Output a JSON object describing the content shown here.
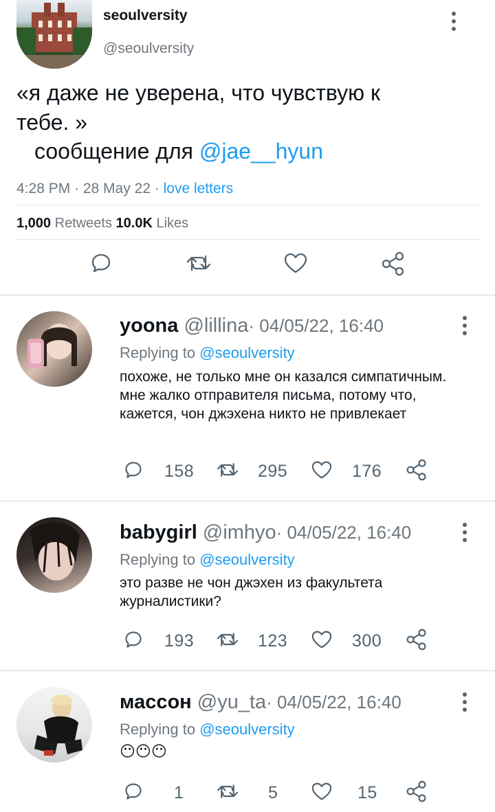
{
  "tweet": {
    "display_name": "seoulversity",
    "handle": "@seoulversity",
    "text_line1": "«я даже не уверена, что чувствую к",
    "text_line2": "тебе. »",
    "text_line3_prefix": "сообщение для ",
    "text_line3_mention": "@jae__hyun",
    "time": "4:28 PM · 28 May 22 · ",
    "source": "love letters",
    "retweets_count": "1,000",
    "retweets_label": " Retweets ",
    "likes_count": "10.0K",
    "likes_label": " Likes"
  },
  "replies": [
    {
      "name": "yoona",
      "handle": "@lillina",
      "timestamp": "· 04/05/22, 16:40",
      "replying_prefix": "Replying to ",
      "replying_handle": "@seoulversity",
      "text": "похоже, не только мне он казался симпатичным. мне жалко отправителя письма, потому что, кажется, чон джэхена никто не привлекает",
      "comments": "158",
      "retweets": "295",
      "likes": "176"
    },
    {
      "name": "babygirl",
      "handle": "@imhyo",
      "timestamp": "· 04/05/22, 16:40",
      "replying_prefix": "Replying to ",
      "replying_handle": "@seoulversity",
      "text": "это разве не чон джэхен из факультета журналистики?",
      "comments": "193",
      "retweets": "123",
      "likes": "300"
    },
    {
      "name": "массон",
      "handle": "@yu_ta",
      "timestamp": "· 04/05/22, 16:40",
      "replying_prefix": "Replying to ",
      "replying_handle": "@seoulversity",
      "text": "😶😶😶",
      "comments": "1",
      "retweets": "5",
      "likes": "15"
    }
  ],
  "icons": {
    "more": "more-vertical-icon",
    "reply": "speech-bubble-icon",
    "retweet": "retweet-icon",
    "like": "heart-icon",
    "share": "share-icon"
  },
  "colors": {
    "link": "#1d9bf0",
    "secondary_text": "#6e767d",
    "icon": "#536471"
  }
}
